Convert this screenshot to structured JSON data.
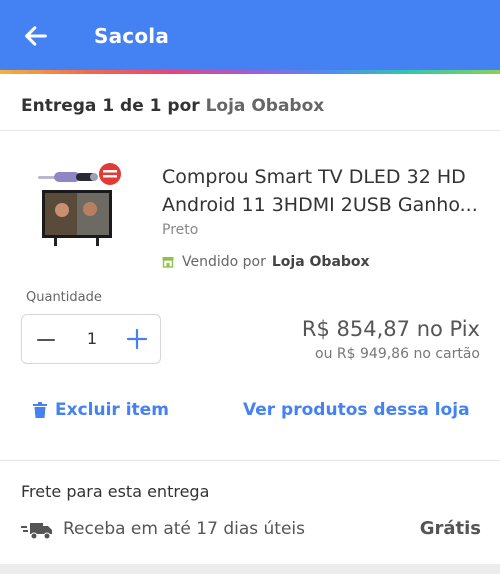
{
  "header": {
    "title": "Sacola",
    "accent": "#4481f2"
  },
  "delivery": {
    "prefix": "Entrega 1 de 1 por",
    "store": "Loja Obabox"
  },
  "product": {
    "name_line1": "Comprou Smart TV DLED 32 HD",
    "name_line2": "Android 11 3HDMI 2USB Ganho...",
    "color": "Preto",
    "seller_prefix": "Vendido por",
    "seller": "Loja Obabox",
    "image": "tv-with-hair-dryer-bundle-image"
  },
  "quantity": {
    "label": "Quantidade",
    "value": "1"
  },
  "pricing": {
    "pix": "R$ 854,87 no Pix",
    "card": "ou R$ 949,86 no cartão"
  },
  "actions": {
    "remove": "Excluir item",
    "store_products": "Ver produtos dessa loja"
  },
  "shipping": {
    "title": "Frete para esta entrega",
    "eta": "Receba em até 17 dias úteis",
    "cost": "Grátis"
  },
  "icons": {
    "back": "arrow-left-icon",
    "store": "store-icon",
    "minus": "minus-icon",
    "plus": "plus-icon",
    "trash": "trash-icon",
    "truck": "truck-icon"
  }
}
